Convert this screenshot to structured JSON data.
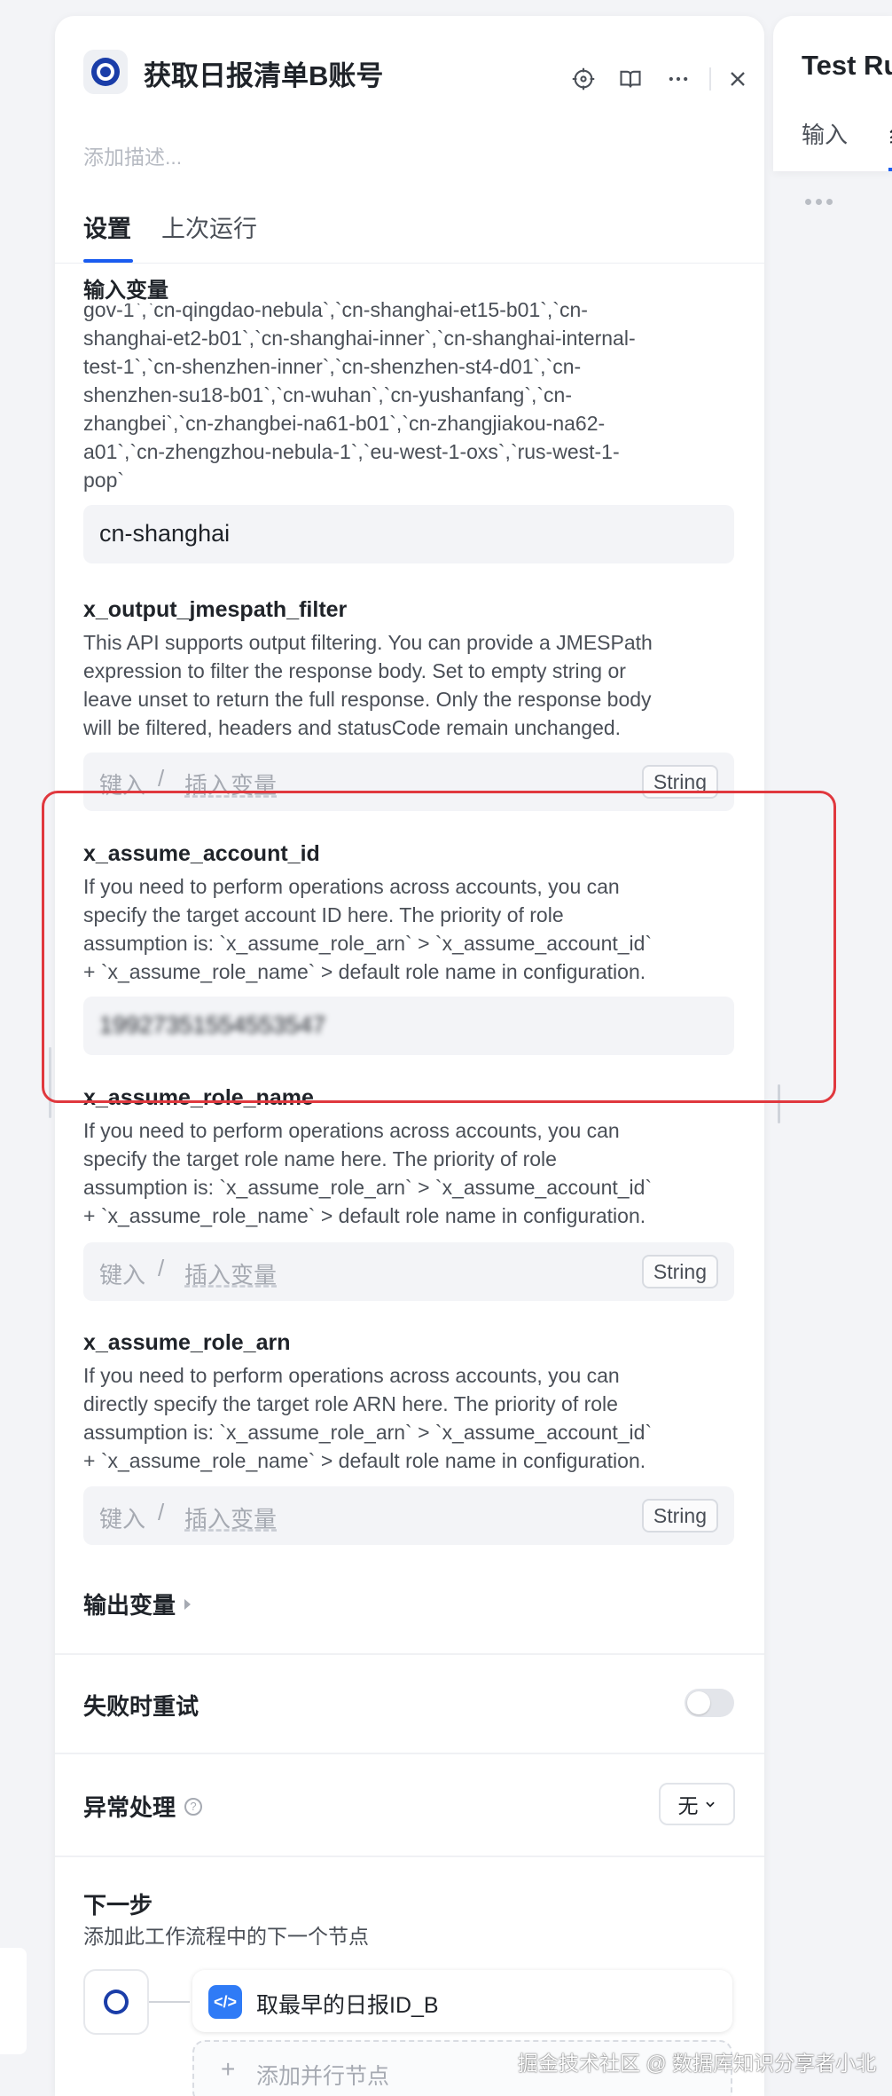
{
  "panel": {
    "title": "获取日报清单B账号",
    "description_placeholder": "添加描述...",
    "tabs": [
      "设置",
      "上次运行"
    ]
  },
  "inputs_section": {
    "title": "输入变量",
    "region_enum_text": "gov-1`,`cn-qingdao-nebula`,`cn-shanghai-et15-b01`,`cn-shanghai-et2-b01`,`cn-shanghai-inner`,`cn-shanghai-internal-test-1`,`cn-shenzhen-inner`,`cn-shenzhen-st4-d01`,`cn-shenzhen-su18-b01`,`cn-wuhan`,`cn-yushanfang`,`cn-zhangbei`,`cn-zhangbei-na61-b01`,`cn-zhangjiakou-na62-a01`,`cn-zhengzhou-nebula-1`,`eu-west-1-oxs`,`rus-west-1-pop`",
    "region_enum_lines": [
      "gov-1`,`cn-qingdao-nebula`,`cn-shanghai-et15-b01`,`cn-",
      "shanghai-et2-b01`,`cn-shanghai-inner`,`cn-shanghai-internal-",
      "test-1`,`cn-shenzhen-inner`,`cn-shenzhen-st4-d01`,`cn-",
      "shenzhen-su18-b01`,`cn-wuhan`,`cn-yushanfang`,`cn-",
      "zhangbei`,`cn-zhangbei-na61-b01`,`cn-zhangjiakou-na62-",
      "a01`,`cn-zhengzhou-nebula-1`,`eu-west-1-oxs`,`rus-west-1-",
      "pop`"
    ],
    "region_value": "cn-shanghai",
    "fields": [
      {
        "name": "x_output_jmespath_filter",
        "description_lines": [
          "This API supports output filtering. You can provide a JMESPath",
          "expression to filter the response body. Set to empty string or",
          "leave unset to return the full response. Only the response body",
          "will be filtered, headers and statusCode remain unchanged."
        ],
        "key_placeholder": "键入",
        "slash": "/",
        "insert_placeholder": "插入变量",
        "type": "String"
      },
      {
        "name": "x_assume_account_id",
        "description_lines": [
          "If you need to perform operations across accounts, you can",
          "specify the target account ID here. The priority of role",
          "assumption is: `x_assume_role_arn` > `x_assume_account_id`",
          "+ `x_assume_role_name` > default role name in configuration."
        ],
        "value": "19927351554553547"
      },
      {
        "name": "x_assume_role_name",
        "description_lines": [
          "If you need to perform operations across accounts, you can",
          "specify the target role name here. The priority of role",
          "assumption is: `x_assume_role_arn` > `x_assume_account_id`",
          "+ `x_assume_role_name` > default role name in configuration."
        ],
        "key_placeholder": "键入",
        "slash": "/",
        "insert_placeholder": "插入变量",
        "type": "String"
      },
      {
        "name": "x_assume_role_arn",
        "description_lines": [
          "If you need to perform operations across accounts, you can",
          "directly specify the target role ARN here. The priority of role",
          "assumption is: `x_assume_role_arn` > `x_assume_account_id`",
          "+ `x_assume_role_name` > default role name in configuration."
        ],
        "key_placeholder": "键入",
        "slash": "/",
        "insert_placeholder": "插入变量",
        "type": "String"
      }
    ]
  },
  "output_section": {
    "title": "输出变量"
  },
  "retry": {
    "label": "失败时重试",
    "enabled": false
  },
  "exception": {
    "label": "异常处理",
    "help": "?",
    "selected": "无"
  },
  "next_step": {
    "title": "下一步",
    "subtitle": "添加此工作流程中的下一个节点",
    "node_label": "取最早的日报ID_B",
    "add_parallel_label": "添加并行节点",
    "add_plus": "+"
  },
  "right_panel": {
    "title": "Test Ru",
    "tab_input": "输入",
    "tab_second": "纟"
  },
  "watermark": "掘金技术社区 @ 数据库知识分享者小北",
  "colors": {
    "accent": "#1a5cf0",
    "highlight_border": "#e0383e",
    "node_icon_blue": "#2f7bf6"
  },
  "icons": [
    "crosshair-icon",
    "book-icon",
    "more-icon",
    "close-icon",
    "eye-logo-icon",
    "code-icon",
    "chevron-down-icon",
    "help-icon",
    "caret-right-icon"
  ]
}
